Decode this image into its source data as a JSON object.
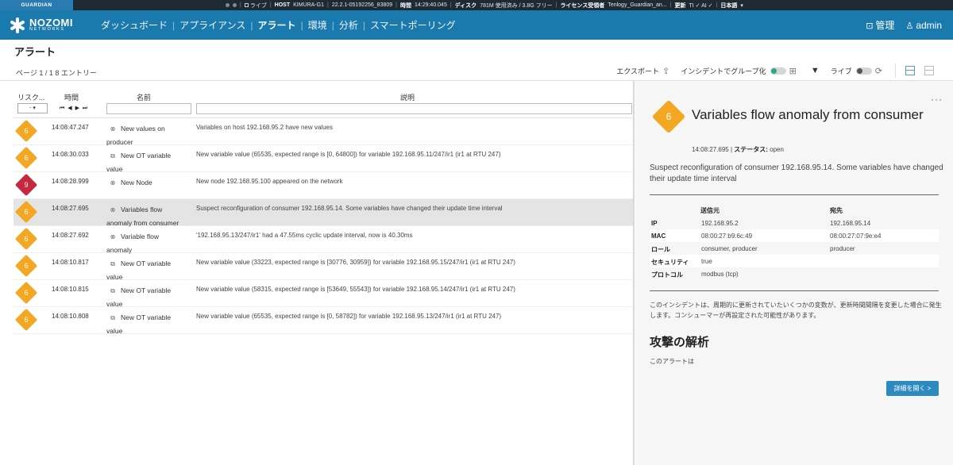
{
  "statusbar": {
    "brand": "GUARDIAN",
    "live": "ライブ",
    "host_label": "HOST",
    "host": "KIMURA-G1",
    "version": "22.2.1-05192256_83809",
    "time_label": "時間",
    "time": "14:29:40.045",
    "disk_label": "ディスク",
    "disk": "781M 使用済み / 3.8G フリー",
    "license_label": "ライセンス受領者",
    "license": "Tenlogy_Guardian_an...",
    "update_label": "更新",
    "update": "TI ✓ AI ✓",
    "language": "日本語"
  },
  "navbar": {
    "logo_line1": "NOZOMI",
    "logo_line2": "NETWORKS",
    "menu": [
      "ダッシュボード",
      "アプライアンス",
      "アラート",
      "環境",
      "分析",
      "スマートポーリング"
    ],
    "manage": "管理",
    "user": "admin"
  },
  "page": {
    "title": "アラート",
    "info": "ページ 1 / 1  8 エントリー"
  },
  "toolbar": {
    "export": "エクスポート",
    "group_by_incident": "インシデントでグループ化",
    "live": "ライブ"
  },
  "table": {
    "headers": {
      "risk": "リスク...",
      "time": "時間",
      "name": "名前",
      "desc": "説明"
    },
    "risk_filter": "-  ▾",
    "time_nav": "⏮ ◀ ▶ ⏭",
    "rows": [
      {
        "risk": "6",
        "time": "14:08:47.247",
        "icon": "⊗",
        "name1": "New values on",
        "name2": "producer",
        "desc": "Variables on host 192.168.95.2 have new values"
      },
      {
        "risk": "6",
        "time": "14:08:30.033",
        "icon": "⧉",
        "name1": "New OT variable",
        "name2": "value",
        "desc": "New variable value (65535, expected range is [0, 64800]) for variable 192.168.95.11/247/ir1 (ir1 at RTU 247)"
      },
      {
        "risk": "9",
        "time": "14:08:28.999",
        "icon": "⊗",
        "name1": "New Node",
        "name2": "",
        "desc": "New node 192.168.95.100 appeared on the network"
      },
      {
        "risk": "6",
        "time": "14:08:27.695",
        "icon": "⊗",
        "name1": "Variables flow",
        "name2": "anomaly from consumer",
        "desc": "Suspect reconfiguration of consumer 192.168.95.14. Some variables have changed their update time interval"
      },
      {
        "risk": "6",
        "time": "14:08:27.692",
        "icon": "⊗",
        "name1": "Variable flow",
        "name2": "anomaly",
        "desc": "'192.168.95.13/247/ir1' had a 47.55ms cyclic update interval, now is 40.30ms"
      },
      {
        "risk": "6",
        "time": "14:08:10.817",
        "icon": "⧉",
        "name1": "New OT variable",
        "name2": "value",
        "desc": "New variable value (33223, expected range is [30776, 30959]) for variable 192.168.95.15/247/ir1 (ir1 at RTU 247)"
      },
      {
        "risk": "6",
        "time": "14:08:10.815",
        "icon": "⧉",
        "name1": "New OT variable",
        "name2": "value",
        "desc": "New variable value (58315, expected range is [53649, 55543]) for variable 192.168.95.14/247/ir1 (ir1 at RTU 247)"
      },
      {
        "risk": "6",
        "time": "14:08:10.808",
        "icon": "⧉",
        "name1": "New OT variable",
        "name2": "value",
        "desc": "New variable value (65535, expected range is [0, 58782]) for variable 192.168.95.13/247/ir1 (ir1 at RTU 247)"
      }
    ]
  },
  "details": {
    "risk": "6",
    "title": "Variables flow anomaly from consumer",
    "time": "14:08:27.695",
    "status_label": "ステータス:",
    "status": "open",
    "description": "Suspect reconfiguration of consumer 192.168.95.14. Some variables have changed their update time interval",
    "col_src": "送信元",
    "col_dst": "宛先",
    "ip_label": "IP",
    "ip_src": "192.168.95.2",
    "ip_dst": "192.168.95.14",
    "mac_label": "MAC",
    "mac_src": "08:00:27:b9:6c:49",
    "mac_dst": "08:00:27:07:9e:e4",
    "role_label": "ロール",
    "role_src": "consumer, producer",
    "role_dst": "producer",
    "security_label": "セキュリティ",
    "security_src": "true",
    "protocol_label": "プロトコル",
    "protocol_src": "modbus (tcp)",
    "note": "このインシデントは、周期的に更新されていたいくつかの変数が、更新時間間隔を変更した場合に発生します。コンシューマーが再設定された可能性があります。",
    "attack_heading": "攻撃の解析",
    "attack_text": "このアラートは",
    "open_details": "詳細を開く >"
  },
  "colors": {
    "nav": "#1a79ad",
    "statusbar": "#1e2a33",
    "risk_medium": "#f4a723",
    "risk_high": "#c8283f",
    "button": "#2d8ac1"
  }
}
